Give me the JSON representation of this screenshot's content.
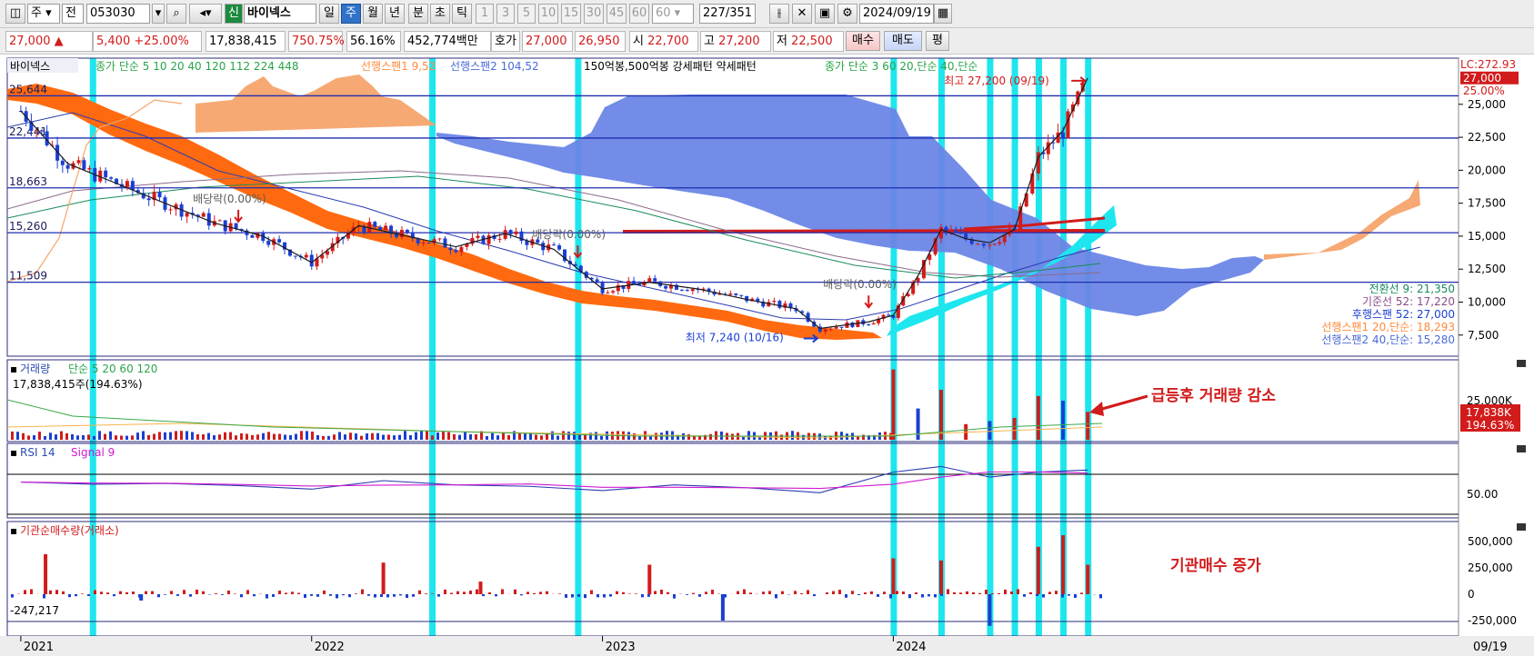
{
  "toolbar": {
    "period_label": "주",
    "type_label": "전",
    "code_value": "053030",
    "market_badge": "신",
    "stock_name": "바이넥스",
    "tf_day": "일",
    "tf_week": "주",
    "tf_month": "월",
    "tf_year": "년",
    "tf_minute": "분",
    "tf_second": "초",
    "tf_tick": "틱",
    "intervals": [
      "1",
      "3",
      "5",
      "10",
      "15",
      "30",
      "45",
      "60"
    ],
    "interval_select": "60",
    "count_current": "227",
    "count_total": "/351",
    "date_value": "2024/09/19"
  },
  "quote": {
    "price": "27,000",
    "change_arrow": "▲",
    "change": "5,400",
    "change_pct": "+25.00%",
    "volume": "17,838,415",
    "volume_ratio": "750.75%",
    "turnover": "56.16%",
    "amount": "452,774백만",
    "hoga_label": "호가",
    "ask": "27,000",
    "bid": "26,950",
    "open_label": "시",
    "open": "22,700",
    "high_label": "고",
    "high": "27,200",
    "low_label": "저",
    "low": "22,500",
    "buy_button": "매수",
    "sell_button": "매도",
    "eval_button": "평"
  },
  "colors": {
    "up": "#d21b1b",
    "down": "#1b3fd2",
    "cyan_band": "#1ee6ee",
    "orange_band": "#ff6a10",
    "cloud_blue": "#6a86e6",
    "cloud_orange": "#f6a46c",
    "hline": "#1f2fb0"
  },
  "chart_data": [
    {
      "type": "line",
      "panel": "price",
      "legend": {
        "name": "바이넥스",
        "ma": "종가 단순 5 10 20 40 120 112 224 448",
        "span1": "선행스팬1 9,52",
        "span2": "선행스팬2 104,52",
        "pattern": "150억봉,500억봉 강세패턴  약세패턴",
        "ma2": "종가 단순 3  60  20,단순  40,단순"
      },
      "lc_label": "LC:272.93",
      "current_price_label": "27,000",
      "current_price": 27000,
      "y_ticks": [
        25000,
        22500,
        20000,
        17500,
        15000,
        12500,
        10000,
        7500
      ],
      "y_tick_labels": [
        "25,000",
        "22,500",
        "20,000",
        "17,500",
        "15,000",
        "12,500",
        "10,000",
        "7,500"
      ],
      "pct_label": "25.00%",
      "ylim": [
        5900,
        28500
      ],
      "hlines": [
        {
          "value": 25644,
          "label": "25,644"
        },
        {
          "value": 22441,
          "label": "22,441"
        },
        {
          "value": 18663,
          "label": "18,663"
        },
        {
          "value": 15260,
          "label": "15,260"
        },
        {
          "value": 11509,
          "label": "11,509"
        }
      ],
      "x_ticks": [
        {
          "date": "2021-01",
          "label": "2021"
        },
        {
          "date": "2022-01",
          "label": "2022"
        },
        {
          "date": "2023-01",
          "label": "2023"
        },
        {
          "date": "2024-01",
          "label": "2024"
        }
      ],
      "x_end_label": "09/19",
      "close_series": {
        "name": "close",
        "dates": [
          "2021-01",
          "2021-03",
          "2021-05",
          "2021-07",
          "2021-09",
          "2021-11",
          "2022-01",
          "2022-03",
          "2022-05",
          "2022-07",
          "2022-09",
          "2022-11",
          "2023-01",
          "2023-03",
          "2023-05",
          "2023-07",
          "2023-09",
          "2023-10",
          "2023-12",
          "2024-01",
          "2024-02",
          "2024-03",
          "2024-04",
          "2024-05",
          "2024-06",
          "2024-07",
          "2024-08",
          "2024-09"
        ],
        "values": [
          24500,
          20500,
          19000,
          17500,
          16000,
          15000,
          13000,
          15800,
          15000,
          14200,
          15200,
          14000,
          11000,
          11500,
          11000,
          10200,
          9500,
          8000,
          8500,
          9000,
          12000,
          15500,
          14800,
          14500,
          15500,
          21000,
          23000,
          27000
        ]
      },
      "annotations": [
        {
          "text": "최고 27,200 (09/19)",
          "date": "2024-09",
          "value": 27200
        },
        {
          "text": "최저 7,240 (10/16)",
          "date": "2023-10",
          "value": 7240
        },
        {
          "text": "배당락(0.00%)",
          "date": "2021-10",
          "value": 17000
        },
        {
          "text": "배당락(0.00%)",
          "date": "2022-12",
          "value": 14300
        },
        {
          "text": "배당락(0.00%)",
          "date": "2023-12",
          "value": 10500
        }
      ],
      "right_info": [
        {
          "text": "전환선 9: 21,350",
          "color": "#1a8b5a"
        },
        {
          "text": "기준선 52: 17,220",
          "color": "#8a4a8a"
        },
        {
          "text": "후행스팬 52: 27,000",
          "color": "#1b3fd2"
        },
        {
          "text": "선행스팬1 20,단순: 18,293",
          "color": "#ff8a3a"
        },
        {
          "text": "선행스팬2 40,단순: 15,280",
          "color": "#4a6ad8"
        }
      ]
    },
    {
      "type": "bar",
      "panel": "volume",
      "legend": {
        "name": "거래량",
        "ma": "단순 5  20  60  120"
      },
      "value_label": "17,838,415주(194.63%)",
      "right_label": "17,838K",
      "right_pct": "194.63%",
      "y_tick_label": "25,000K",
      "annotation": "급등후 거래량 감소",
      "dates": [
        "2024-01",
        "2024-02",
        "2024-03",
        "2024-04",
        "2024-05",
        "2024-06",
        "2024-07",
        "2024-08",
        "2024-09"
      ],
      "values": [
        45000,
        20000,
        32000,
        10000,
        12000,
        14000,
        28000,
        25000,
        17838
      ]
    },
    {
      "type": "line",
      "panel": "rsi",
      "legend": {
        "name": "RSI 14",
        "signal": "Signal 9"
      },
      "y_tick_label": "50.00",
      "rsi": {
        "dates": [
          "2021-01",
          "2021-04",
          "2021-07",
          "2021-10",
          "2022-01",
          "2022-04",
          "2022-07",
          "2022-10",
          "2023-01",
          "2023-04",
          "2023-07",
          "2023-10",
          "2024-01",
          "2024-03",
          "2024-05",
          "2024-07",
          "2024-09"
        ],
        "values": [
          48,
          45,
          46,
          43,
          38,
          50,
          44,
          42,
          36,
          44,
          40,
          33,
          62,
          70,
          55,
          62,
          65
        ]
      }
    },
    {
      "type": "bar",
      "panel": "institution",
      "legend": {
        "name": "기관순매수량(거래소)"
      },
      "min_label": "-247,217",
      "y_tick_labels": [
        "500,000",
        "250,000",
        "0",
        "-250,000"
      ],
      "annotation": "기관매수 증가",
      "dates": [
        "2021-02",
        "2021-06",
        "2022-04",
        "2022-08",
        "2023-03",
        "2023-06",
        "2024-01",
        "2024-03",
        "2024-05",
        "2024-07",
        "2024-08",
        "2024-09"
      ],
      "values": [
        380000,
        -60000,
        300000,
        120000,
        280000,
        -250000,
        340000,
        320000,
        -300000,
        450000,
        560000,
        280000
      ]
    }
  ]
}
